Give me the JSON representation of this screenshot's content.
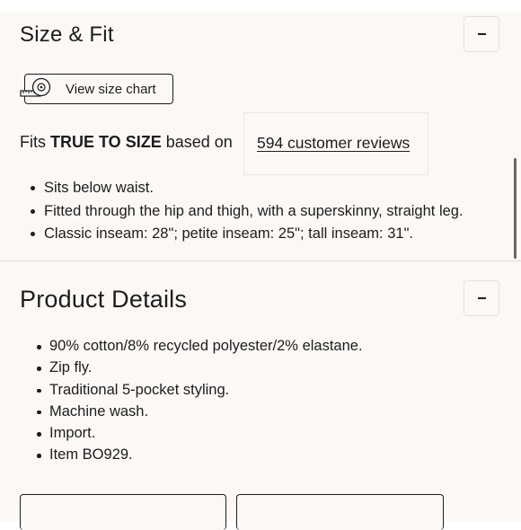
{
  "size_fit": {
    "title": "Size & Fit",
    "toggle_label": "-",
    "size_chart_label": "View size chart",
    "fit_prefix": "Fits",
    "fit_value": "TRUE TO SIZE",
    "fit_suffix": "based on",
    "reviews_link": "594 customer reviews",
    "bullets": [
      "Sits below waist.",
      "Fitted through the hip and thigh, with a superskinny, straight leg.",
      "Classic inseam: 28\"; petite inseam: 25\"; tall inseam: 31\"."
    ]
  },
  "product_details": {
    "title": "Product Details",
    "toggle_label": "-",
    "bullets": [
      "90% cotton/8% recycled polyester/2% elastane.",
      "Zip fly.",
      "Traditional 5-pocket styling.",
      "Machine wash.",
      "Import.",
      "Item BO929."
    ]
  },
  "icons": {
    "size_chart": "measuring-tape-icon",
    "toggle": "minus-icon"
  },
  "colors": {
    "background": "#fcf8f5",
    "text": "#1d1d1b",
    "border": "#e6e1dc"
  }
}
